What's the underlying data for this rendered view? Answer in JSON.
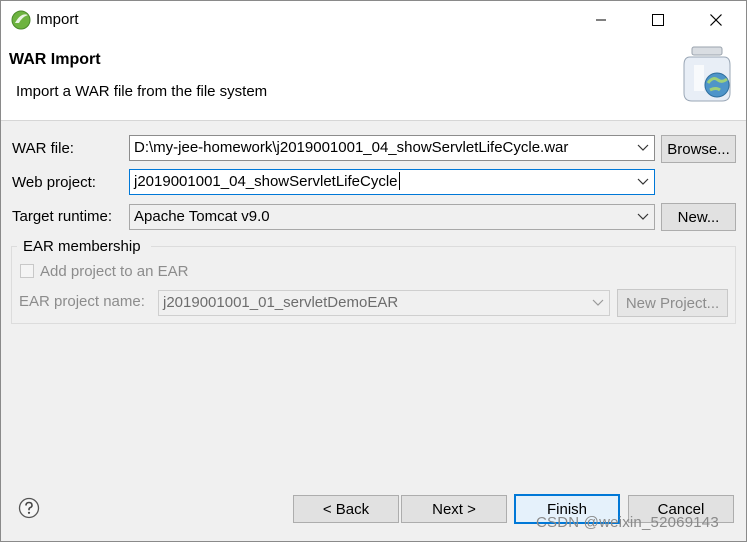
{
  "window": {
    "title": "Import",
    "controls": {
      "minimize": "minimize",
      "maximize": "maximize",
      "close": "close"
    }
  },
  "header": {
    "title": "WAR Import",
    "description": "Import a WAR file from the file system",
    "icon": "war-file-jar-icon"
  },
  "form": {
    "war_file": {
      "label": "WAR file:",
      "value": "D:\\my-jee-homework\\j2019001001_04_showServletLifeCycle.war",
      "button": "Browse..."
    },
    "web_project": {
      "label": "Web project:",
      "value": "j2019001001_04_showServletLifeCycle"
    },
    "target_runtime": {
      "label": "Target runtime:",
      "value": "Apache Tomcat v9.0",
      "button": "New..."
    }
  },
  "ear": {
    "group_title": "EAR membership",
    "checkbox_label": "Add project to an EAR",
    "checkbox_checked": false,
    "project_name_label": "EAR project name:",
    "project_name_value": "j2019001001_01_servletDemoEAR",
    "new_project_button": "New Project..."
  },
  "footer": {
    "help_icon": "help-icon",
    "back": "< Back",
    "next": "Next >",
    "finish": "Finish",
    "cancel": "Cancel"
  },
  "watermark": "CSDN @weixin_52069143",
  "colors": {
    "focus_border": "#0078d7",
    "dialog_bg": "#f0f0f0",
    "header_bg": "#ffffff"
  }
}
